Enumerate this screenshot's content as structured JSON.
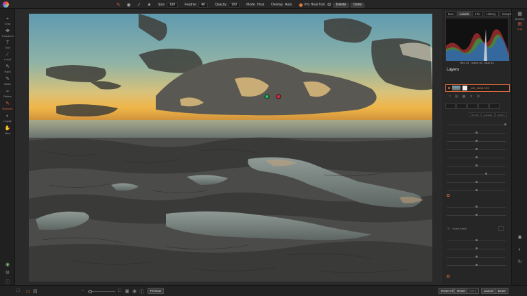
{
  "toolbar": {
    "size_label": "Size",
    "size_value": "100",
    "feather_label": "Feather",
    "feather_value": "40",
    "opacity_label": "Opacity",
    "opacity_value": "100",
    "mode_label": "Mode",
    "mode_value": "Heal",
    "overlay_label": "Overlay",
    "overlay_value": "Auto",
    "heal_tool_label": "Pro Heal Tool",
    "delete_label": "Delete",
    "done_label": "Done"
  },
  "left_tools": [
    {
      "label": "Crop",
      "icon": "crop-icon"
    },
    {
      "label": "Transform",
      "icon": "transform-icon"
    },
    {
      "label": "Text",
      "icon": "text-icon"
    },
    {
      "label": "Local",
      "icon": "brush-icon"
    },
    {
      "label": "Paint",
      "icon": "paint-icon"
    },
    {
      "label": "Mask",
      "icon": "mask-icon"
    },
    {
      "label": "Refine",
      "icon": "refine-icon"
    },
    {
      "label": "Retouch",
      "icon": "retouch-icon"
    },
    {
      "label": "Liquify",
      "icon": "liquify-icon"
    },
    {
      "label": "View",
      "icon": "view-icon"
    }
  ],
  "right_tools": [
    {
      "label": "Browse",
      "icon": "browse-icon"
    },
    {
      "label": "Edit",
      "icon": "edit-icon"
    }
  ],
  "panel": {
    "tabs": [
      "Nav",
      "Levels",
      "Info",
      "History",
      "Snapshots"
    ],
    "active_tab": "Levels",
    "histogram_readout": {
      "red": "Red 43",
      "green": "Green 40",
      "blue": "Blue 43"
    },
    "layers_title": "Layers",
    "layer_name": "_MG_0608.CR2",
    "mode_options": [
      "Normal",
      "Contrast",
      "Darken"
    ],
    "invert_label": "Invert Mask"
  },
  "bottom": {
    "preview_label": "Preview",
    "reset_all_label": "Reset All",
    "reset_label": "Reset",
    "save_label": "Save",
    "cancel_label": "Cancel",
    "done_label": "Done"
  },
  "colors": {
    "accent": "#e06a3a",
    "panel_bg": "#262626",
    "toolbar_bg": "#262626",
    "canvas_bg": "#2a2a2a"
  }
}
